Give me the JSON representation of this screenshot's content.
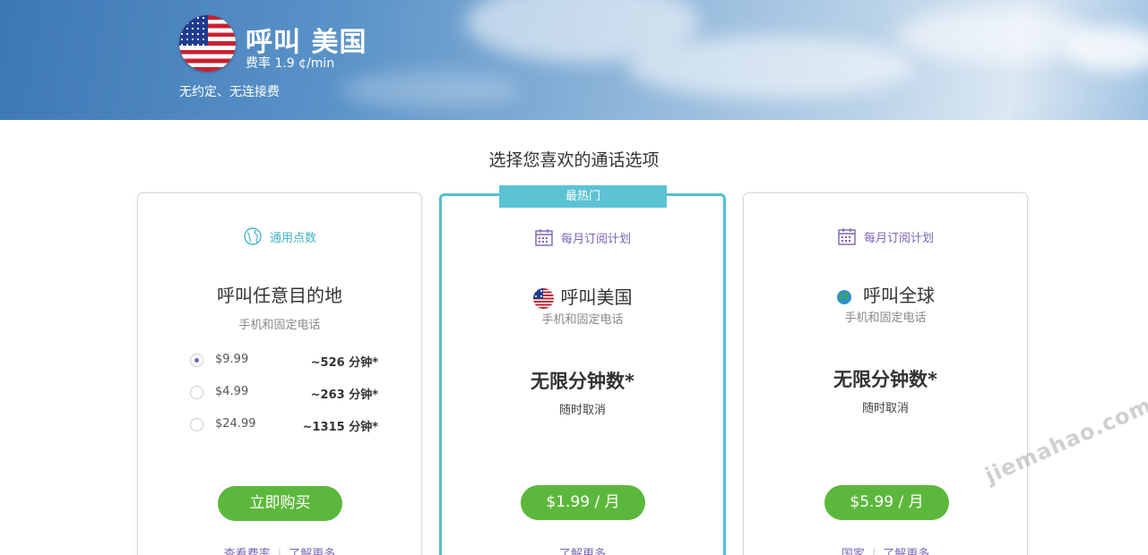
{
  "hero": {
    "title": "呼叫 美国",
    "rate": "费率 1.9  ¢/min",
    "subtitle": "无约定、无连接费",
    "flag_icon": "us-flag-icon"
  },
  "section_title": "选择您喜欢的通话选项",
  "cards": [
    {
      "kind": "通用点数",
      "kind_icon": "globe-icon",
      "title": "呼叫任意目的地",
      "subtitle": "手机和固定电话",
      "options": [
        {
          "price": "$9.99",
          "minutes": "~526 分钟*",
          "selected": true
        },
        {
          "price": "$4.99",
          "minutes": "~263 分钟*",
          "selected": false
        },
        {
          "price": "$24.99",
          "minutes": "~1315 分钟*",
          "selected": false
        }
      ],
      "button": "立即购买",
      "links": [
        "查看费率",
        "了解更多"
      ]
    },
    {
      "ribbon": "最热门",
      "kind": "每月订阅计划",
      "kind_icon": "calendar-icon",
      "title": "呼叫美国",
      "title_icon": "us-flag-icon",
      "subtitle": "手机和固定电话",
      "headline": "无限分钟数*",
      "note": "随时取消",
      "button": "$1.99 / 月",
      "links": [
        "了解更多"
      ]
    },
    {
      "kind": "每月订阅计划",
      "kind_icon": "calendar-icon",
      "title": "呼叫全球",
      "title_icon": "earth-icon",
      "subtitle": "手机和固定电话",
      "headline": "无限分钟数*",
      "note": "随时取消",
      "button": "$5.99 / 月",
      "links": [
        "国家",
        "了解更多"
      ]
    }
  ],
  "watermark": "jiemahao.com",
  "colors": {
    "accent_teal": "#55c0d0",
    "accent_purple": "#7a64b5",
    "button_green": "#5cb83c"
  }
}
